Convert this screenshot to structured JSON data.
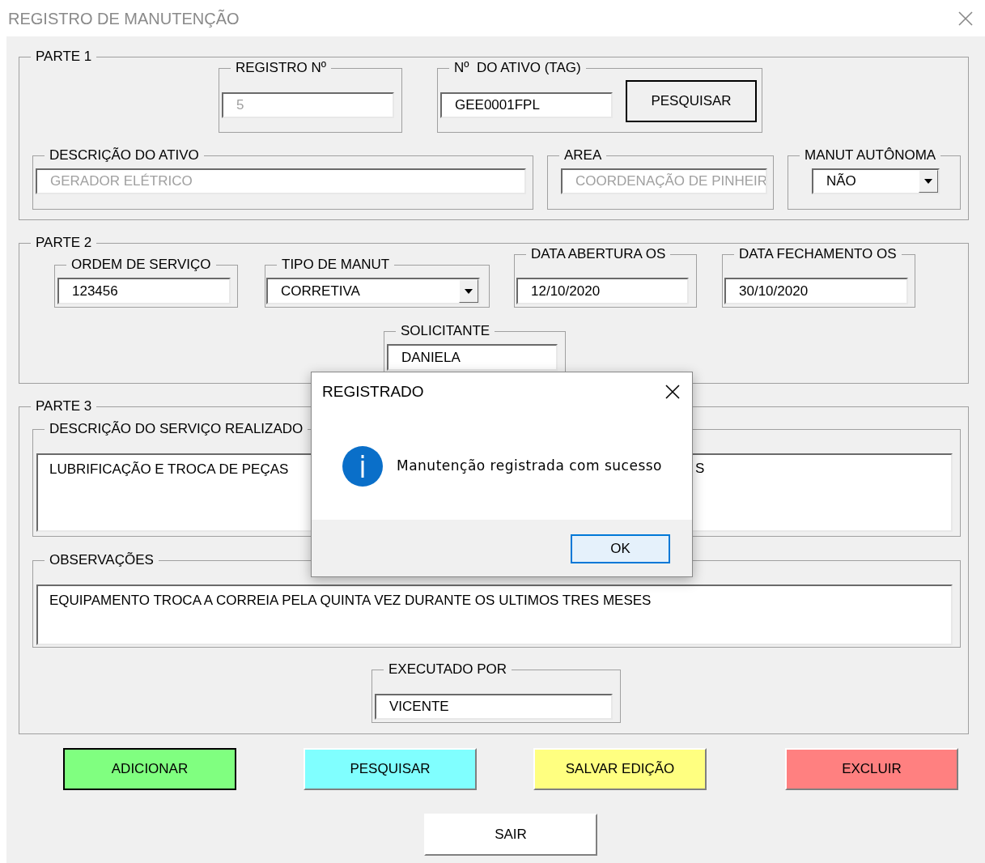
{
  "window": {
    "title": "REGISTRO DE MANUTENÇÃO"
  },
  "parte1": {
    "title": "PARTE 1",
    "registro": {
      "label": "REGISTRO Nº",
      "value": "5",
      "disabled": true
    },
    "tag": {
      "label": "Nº  DO ATIVO (TAG)",
      "value": "GEE0001FPL",
      "disabled": false
    },
    "search_button": "PESQUISAR",
    "descricao": {
      "label": "DESCRIÇÃO DO ATIVO",
      "value": "GERADOR ELÉTRICO",
      "disabled": true
    },
    "area": {
      "label": "AREA",
      "value": "COORDENAÇÃO DE PINHEIR",
      "disabled": true
    },
    "manut_autonoma": {
      "label": "MANUT AUTÔNOMA",
      "value": "NÃO",
      "disabled": false
    }
  },
  "parte2": {
    "title": "PARTE 2",
    "ordem": {
      "label": "ORDEM DE SERVIÇO",
      "value": "123456",
      "disabled": false
    },
    "tipo": {
      "label": "TIPO DE MANUT",
      "value": "CORRETIVA",
      "disabled": false
    },
    "abertura": {
      "label": "DATA ABERTURA OS",
      "value": "12/10/2020",
      "disabled": false
    },
    "fechamento": {
      "label": "DATA FECHAMENTO OS",
      "value": "30/10/2020",
      "disabled": false
    },
    "solicitante": {
      "label": "SOLICITANTE",
      "value": "DANIELA",
      "disabled": false
    }
  },
  "parte3": {
    "title": "PARTE 3",
    "servico": {
      "label": "DESCRIÇÃO DO SERVIÇO REALIZADO",
      "value": "LUBRIFICAÇÃO E TROCA DE PEÇAS",
      "value_tail": "S",
      "disabled": false
    },
    "observacoes": {
      "label": "OBSERVAÇÕES",
      "value": "EQUIPAMENTO TROCA A CORREIA PELA QUINTA VEZ DURANTE OS ULTIMOS TRES MESES",
      "disabled": false
    },
    "executado": {
      "label": "EXECUTADO POR",
      "value": "VICENTE",
      "disabled": false
    }
  },
  "buttons": [
    {
      "label": "ADICIONAR",
      "color": "#80ff80",
      "default": true
    },
    {
      "label": "PESQUISAR",
      "color": "#80ffff",
      "default": false
    },
    {
      "label": "SALVAR EDIÇÃO",
      "color": "#ffff80",
      "default": false
    },
    {
      "label": "EXCLUIR",
      "color": "#ff8080",
      "default": false
    },
    {
      "label": "SAIR",
      "color": "#ffffff",
      "default": false
    }
  ],
  "dialog": {
    "title": "REGISTRADO",
    "message": "Manutenção registrada com sucesso",
    "ok_button": "OK"
  }
}
